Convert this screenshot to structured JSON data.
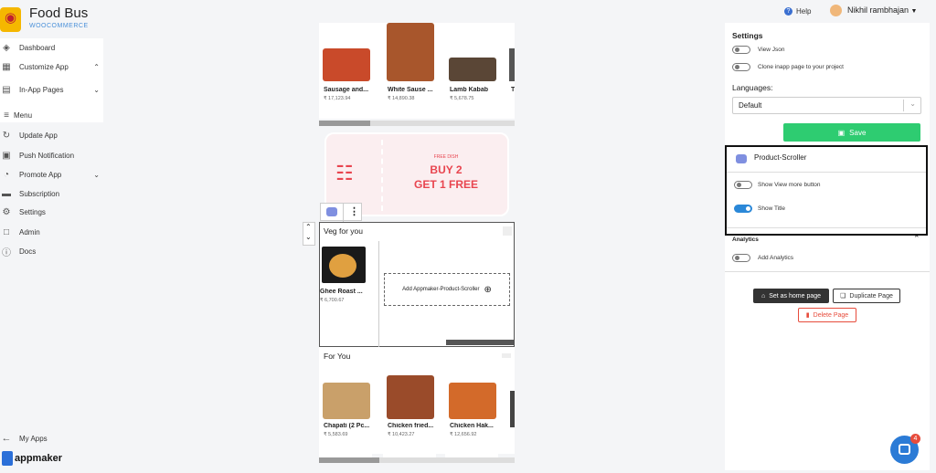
{
  "brand": {
    "title": "Food Bus",
    "subtitle": "WOOCOMMERCE",
    "logo_icon": "location-pin-icon"
  },
  "topbar": {
    "help": "Help",
    "user": "Nikhil rambhajan"
  },
  "sidebar": {
    "items": [
      {
        "label": "Dashboard",
        "icon": "layers-icon"
      },
      {
        "label": "Customize App",
        "icon": "grid-icon"
      },
      {
        "label": "In-App Pages",
        "icon": "pages-icon"
      },
      {
        "label": "Menu",
        "icon": "menu-icon"
      },
      {
        "label": "Update App",
        "icon": "refresh-icon"
      },
      {
        "label": "Push Notification",
        "icon": "notification-icon"
      },
      {
        "label": "Promote App",
        "icon": "pie-icon"
      },
      {
        "label": "Subscription",
        "icon": "card-icon"
      },
      {
        "label": "Settings",
        "icon": "gear-icon"
      },
      {
        "label": "Admin",
        "icon": "bookmark-icon"
      },
      {
        "label": "Docs",
        "icon": "help-icon"
      }
    ],
    "my_apps": "My Apps",
    "footer_brand": "appmaker"
  },
  "canvas": {
    "top_row": [
      {
        "name": "Sausage and...",
        "price": "₹ 17,123.94"
      },
      {
        "name": "White Sause ...",
        "price": "₹ 14,890.38"
      },
      {
        "name": "Lamb Kabab",
        "price": "₹ 5,678.75"
      }
    ],
    "banner": {
      "small": "FREE DISH",
      "line1": "BUY 2",
      "line2": "GET 1 FREE"
    },
    "veg_title": "Veg for you",
    "veg_item": {
      "name": "Ghee Roast ...",
      "price": "₹ 6,700.67"
    },
    "add_block": "Add Appmaker-Product-Scroller",
    "for_you_title": "For You",
    "bottom_row": [
      {
        "name": "Chapati (2 Pc...",
        "price": "₹ 5,583.69"
      },
      {
        "name": "Chicken fried...",
        "price": "₹ 10,423.27"
      },
      {
        "name": "Chicken Hak...",
        "price": "₹ 12,656.92"
      }
    ]
  },
  "settings": {
    "title": "Settings",
    "view_json": "View Json",
    "clone": "Clone inapp page to your project",
    "languages_label": "Languages:",
    "language_value": "Default",
    "save": "Save",
    "block_name": "Product-Scroller",
    "show_view_more": "Show View more button",
    "show_title": "Show Title",
    "analytics": "Analytics",
    "add_analytics": "Add Analytics",
    "set_home": "Set as home page",
    "duplicate": "Duplicate Page",
    "delete": "Delete Page"
  },
  "chat": {
    "badge": "4"
  },
  "colors": {
    "accent": "#2b88d8",
    "save": "#2ecc71",
    "delete": "#e74c3c",
    "banner": "#e8454f"
  }
}
